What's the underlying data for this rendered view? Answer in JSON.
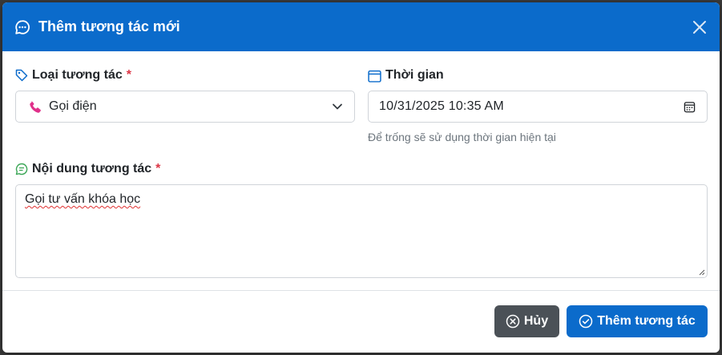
{
  "modal": {
    "title": "Thêm tương tác mới",
    "colors": {
      "header": "#0b6bcb",
      "required": "#dc3545",
      "cancel": "#4b5157",
      "primary": "#0b6bcb"
    }
  },
  "form": {
    "type": {
      "label": "Loại tương tác",
      "required_mark": "*",
      "selected": "Gọi điện",
      "selected_icon": "phone-icon"
    },
    "time": {
      "label": "Thời gian",
      "value": "10/31/2025 10:35  AM",
      "hint": "Để trống sẽ sử dụng thời gian hiện tại"
    },
    "content": {
      "label": "Nội dung tương tác",
      "required_mark": "*",
      "value": "Gọi tư vấn khóa học"
    }
  },
  "footer": {
    "cancel_label": "Hủy",
    "submit_label": "Thêm tương tác"
  }
}
